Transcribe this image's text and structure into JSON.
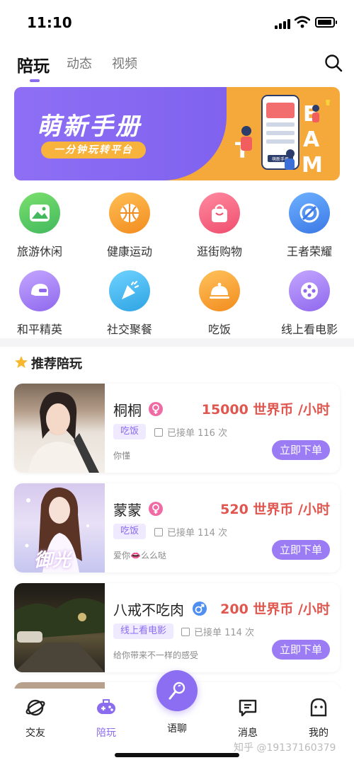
{
  "status": {
    "time": "11:10"
  },
  "header": {
    "tabs": [
      "陪玩",
      "动态",
      "视频"
    ],
    "active": 0
  },
  "banner": {
    "title": "萌新手册",
    "subtitle": "一分钟玩转平台",
    "art_letters": "TEAM",
    "art_card_label": "萌新手册"
  },
  "categories": [
    {
      "label": "旅游休闲",
      "color": "#5ccb6a",
      "icon": "landscape-icon"
    },
    {
      "label": "健康运动",
      "color": "#f6a23b",
      "icon": "basketball-icon"
    },
    {
      "label": "逛街购物",
      "color": "#f6647f",
      "icon": "shopping-bag-icon"
    },
    {
      "label": "王者荣耀",
      "color": "#4e8ff0",
      "icon": "game-emblem-icon"
    },
    {
      "label": "和平精英",
      "color": "#a57ff2",
      "icon": "helmet-icon"
    },
    {
      "label": "社交聚餐",
      "color": "#38b6ea",
      "icon": "party-popper-icon"
    },
    {
      "label": "吃饭",
      "color": "#f6a23b",
      "icon": "cloche-icon"
    },
    {
      "label": "线上看电影",
      "color": "#a57ff2",
      "icon": "film-reel-icon"
    }
  ],
  "section": {
    "title": "推荐陪玩"
  },
  "companions": [
    {
      "name": "桐桐",
      "gender": "female",
      "price": "15000 世界币 /小时",
      "tag": "吃饭",
      "orders": "已接单 116 次",
      "desc": "你懂",
      "button": "立即下单"
    },
    {
      "name": "蒙蒙",
      "gender": "female",
      "price": "520 世界币 /小时",
      "tag": "吃饭",
      "orders": "已接单 114 次",
      "desc": "爱你👄么么哒",
      "button": "立即下单",
      "photo_text": "御光"
    },
    {
      "name": "八戒不吃肉",
      "gender": "male",
      "price": "200 世界币 /小时",
      "tag": "线上看电影",
      "orders": "已接单 114 次",
      "desc": "给你带来不一样的感受",
      "button": "立即下单"
    }
  ],
  "nav": {
    "items": [
      "交友",
      "陪玩",
      "语聊",
      "消息",
      "我的"
    ],
    "active": 1
  },
  "watermark": "知乎 @19137160379",
  "colors": {
    "accent": "#8b6cf0",
    "price": "#e0574f"
  }
}
